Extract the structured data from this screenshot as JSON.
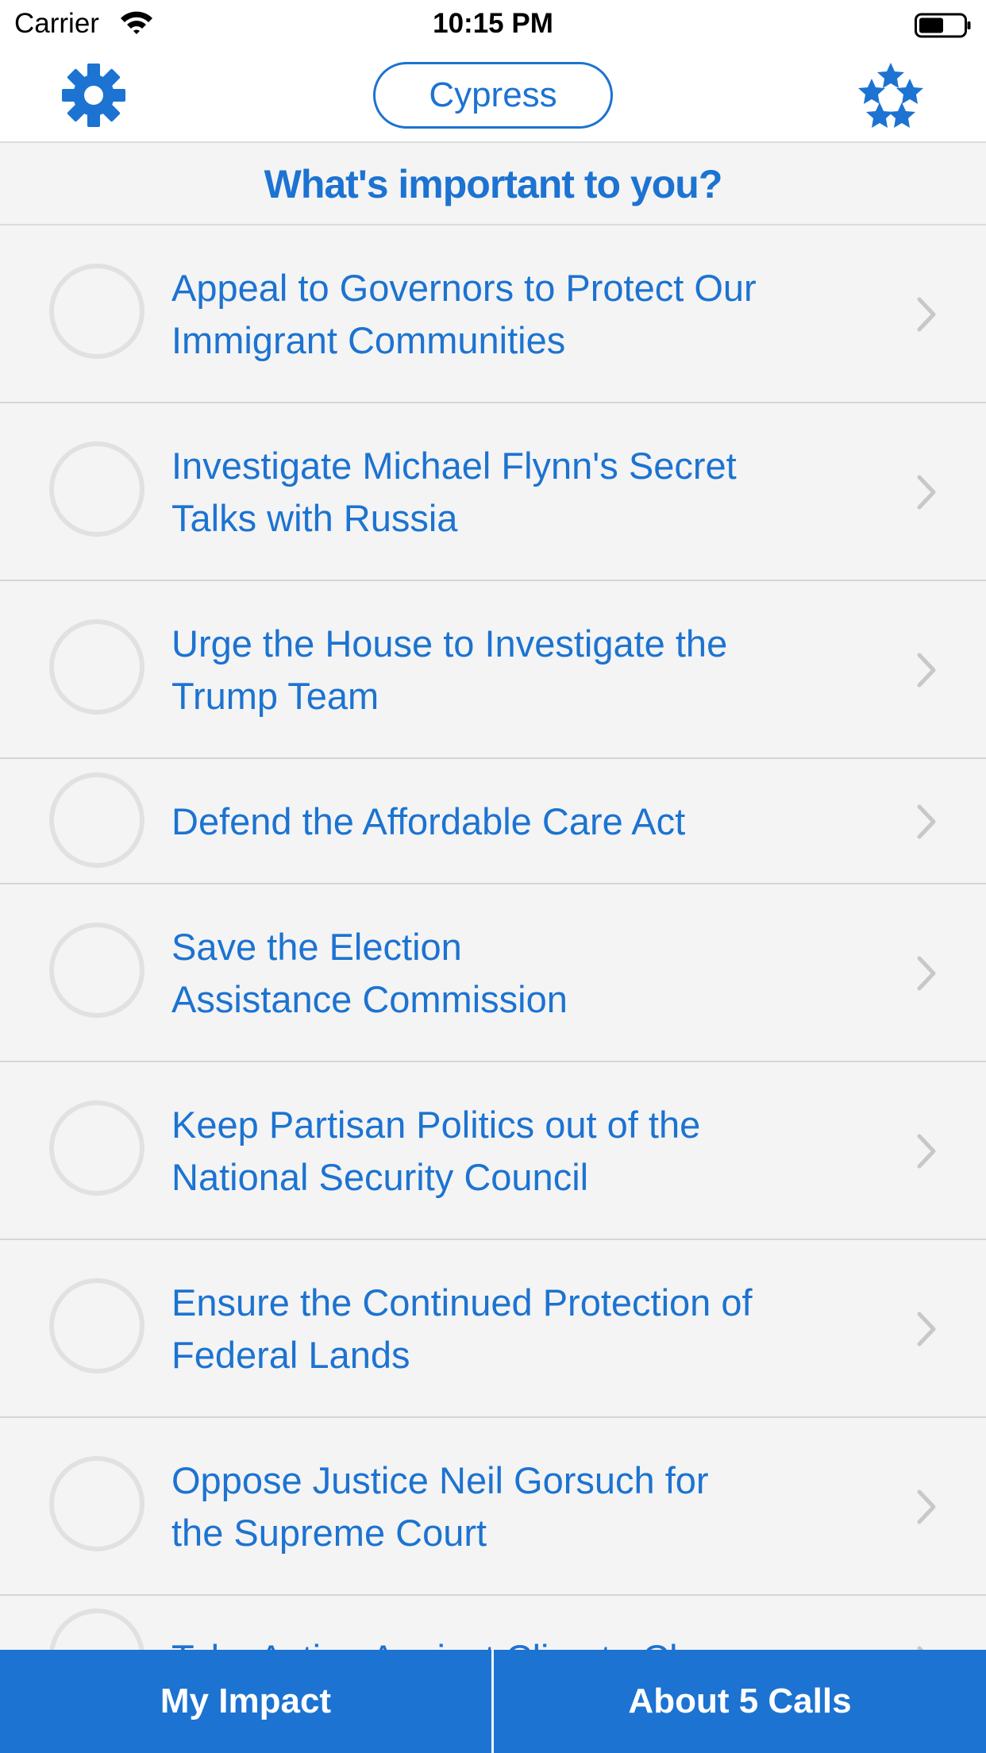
{
  "status_bar": {
    "carrier": "Carrier",
    "time": "10:15 PM",
    "battery_icon": "battery-icon",
    "wifi_icon": "wifi-icon"
  },
  "nav": {
    "location_label": "Cypress",
    "settings_icon": "gear-icon",
    "stars_icon": "stars-icon"
  },
  "header": {
    "title": "What's important to you?"
  },
  "issues": [
    {
      "line1": "Appeal to Governors to Protect Our",
      "line2": "Immigrant Communities"
    },
    {
      "line1": "Investigate Michael Flynn's Secret",
      "line2": "Talks with Russia"
    },
    {
      "line1": "Urge the House to Investigate the",
      "line2": "Trump Team"
    },
    {
      "line1": "Defend the Affordable Care Act",
      "line2": ""
    },
    {
      "line1": "Save the Election",
      "line2": "Assistance Commission"
    },
    {
      "line1": "Keep Partisan Politics out of the",
      "line2": "National Security Council"
    },
    {
      "line1": "Ensure the Continued Protection of",
      "line2": "Federal Lands"
    },
    {
      "line1": "Oppose Justice Neil Gorsuch for",
      "line2": "the Supreme Court"
    },
    {
      "line1": "Take Action Against Climate Change",
      "line2": ""
    }
  ],
  "tabs": {
    "impact_label": "My Impact",
    "about_label": "About 5 Calls"
  },
  "colors": {
    "accent": "#1c73d1",
    "background": "#f4f4f4",
    "circle": "#e1e1e1",
    "chevron": "#c7c7cc"
  }
}
